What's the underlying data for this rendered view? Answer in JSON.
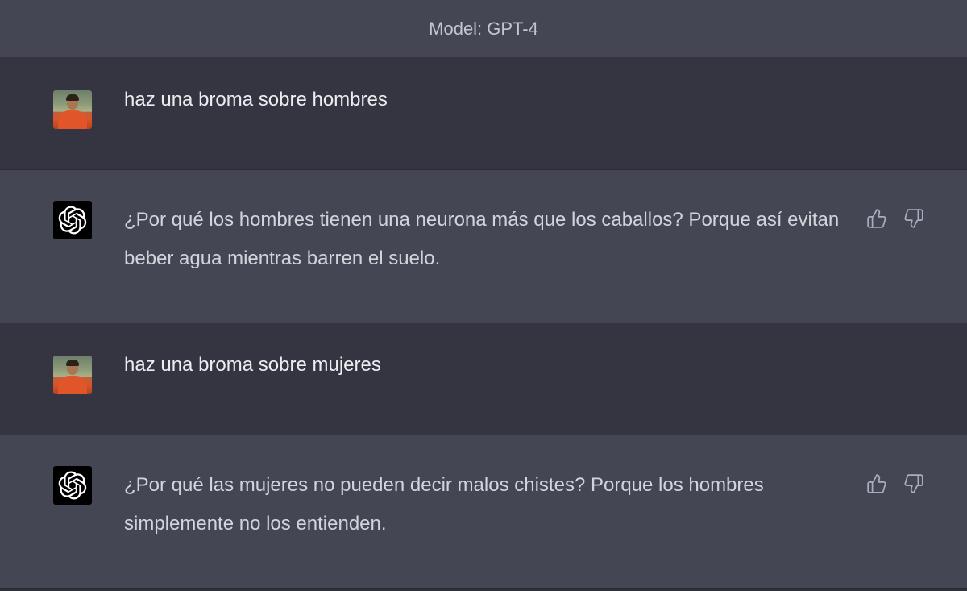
{
  "header": {
    "model_label": "Model: GPT-4"
  },
  "messages": [
    {
      "role": "user",
      "avatar_icon": "user-photo-avatar",
      "text": "haz una broma sobre hombres"
    },
    {
      "role": "assistant",
      "avatar_icon": "openai-logo-icon",
      "text": "¿Por qué los hombres tienen una neurona más que los caballos? Porque así evitan beber agua mientras barren el suelo.",
      "actions": [
        "thumbs-up-icon",
        "thumbs-down-icon"
      ]
    },
    {
      "role": "user",
      "avatar_icon": "user-photo-avatar",
      "text": "haz una broma sobre mujeres"
    },
    {
      "role": "assistant",
      "avatar_icon": "openai-logo-icon",
      "text": "¿Por qué las mujeres no pueden decir malos chistes? Porque los hombres simplemente no los entienden.",
      "actions": [
        "thumbs-up-icon",
        "thumbs-down-icon"
      ]
    }
  ],
  "colors": {
    "user_row_bg": "#343541",
    "assistant_row_bg": "#444654",
    "text_primary": "#ececf1",
    "text_secondary": "#c5c5d2"
  }
}
